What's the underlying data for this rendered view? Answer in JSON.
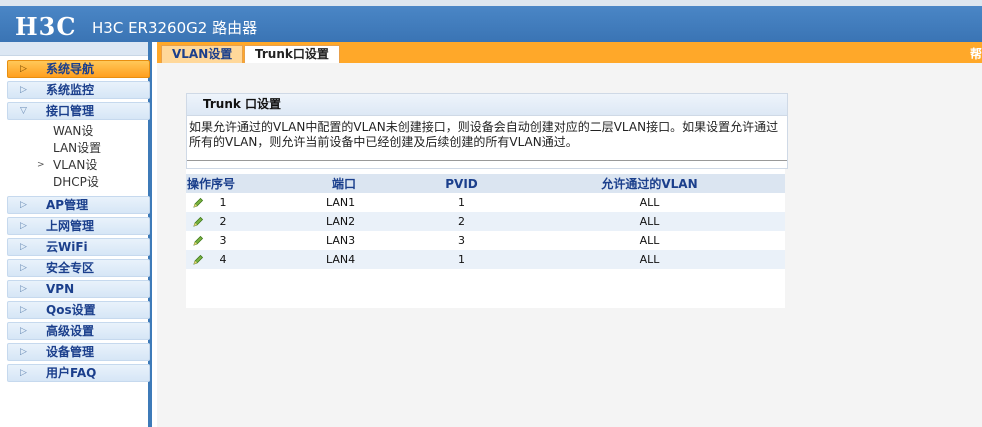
{
  "header": {
    "logo": "H3C",
    "product": "H3C ER3260G2 路由器"
  },
  "sidebar": {
    "items": [
      {
        "label": "系统导航",
        "active": true
      },
      {
        "label": "系统监控"
      },
      {
        "label": "接口管理",
        "expanded": true
      },
      {
        "label": "AP管理"
      },
      {
        "label": "上网管理"
      },
      {
        "label": "云WiFi"
      },
      {
        "label": "安全专区"
      },
      {
        "label": "VPN"
      },
      {
        "label": "Qos设置"
      },
      {
        "label": "高级设置"
      },
      {
        "label": "设备管理"
      },
      {
        "label": "用户FAQ"
      }
    ],
    "sub_items": [
      "WAN设",
      "LAN设置",
      "VLAN设",
      "DHCP设"
    ]
  },
  "tabs": [
    {
      "label": "VLAN设置"
    },
    {
      "label": "Trunk口设置"
    }
  ],
  "help_label": "帮",
  "panel": {
    "title": "Trunk 口设置",
    "desc_line1": "如果允许通过的VLAN中配置的VLAN未创建接口，则设备会自动创建对应的二层VLAN接口。如果设置允许通过",
    "desc_line2": "所有的VLAN，则允许当前设备中已经创建及后续创建的所有VLAN通过。"
  },
  "table": {
    "headers": [
      "操作序号",
      "端口",
      "PVID",
      "允许通过的VLAN"
    ],
    "rows": [
      {
        "idx": "1",
        "port": "LAN1",
        "pvid": "1",
        "vlan": "ALL"
      },
      {
        "idx": "2",
        "port": "LAN2",
        "pvid": "2",
        "vlan": "ALL"
      },
      {
        "idx": "3",
        "port": "LAN3",
        "pvid": "3",
        "vlan": "ALL"
      },
      {
        "idx": "4",
        "port": "LAN4",
        "pvid": "1",
        "vlan": "ALL"
      }
    ]
  },
  "colors": {
    "header_blue": "#3a74b4",
    "tab_orange": "#ffa829",
    "nav_active": "#ff9f1f",
    "link_blue": "#1b3f8c"
  }
}
